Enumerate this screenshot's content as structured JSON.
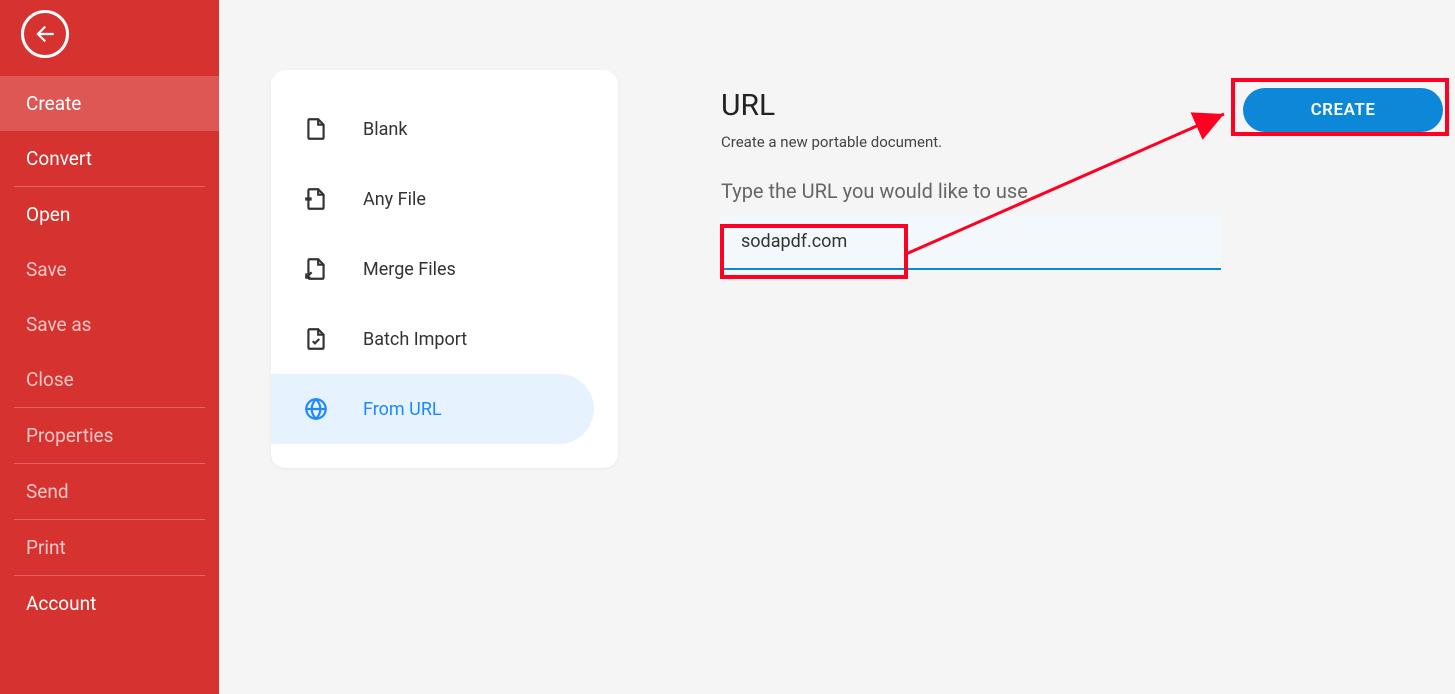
{
  "sidebar": {
    "items": [
      {
        "label": "Create",
        "active": true,
        "bright": true,
        "divider": false
      },
      {
        "label": "Convert",
        "active": false,
        "bright": true,
        "divider": true
      },
      {
        "label": "Open",
        "active": false,
        "bright": true,
        "divider": false
      },
      {
        "label": "Save",
        "active": false,
        "bright": false,
        "divider": false
      },
      {
        "label": "Save as",
        "active": false,
        "bright": false,
        "divider": false
      },
      {
        "label": "Close",
        "active": false,
        "bright": false,
        "divider": true
      },
      {
        "label": "Properties",
        "active": false,
        "bright": false,
        "divider": true
      },
      {
        "label": "Send",
        "active": false,
        "bright": false,
        "divider": true
      },
      {
        "label": "Print",
        "active": false,
        "bright": false,
        "divider": true
      },
      {
        "label": "Account",
        "active": false,
        "bright": true,
        "divider": false
      }
    ]
  },
  "createOptions": {
    "items": [
      {
        "label": "Blank",
        "icon": "file-icon",
        "selected": false
      },
      {
        "label": "Any File",
        "icon": "anyfile-icon",
        "selected": false
      },
      {
        "label": "Merge Files",
        "icon": "merge-icon",
        "selected": false
      },
      {
        "label": "Batch Import",
        "icon": "batch-icon",
        "selected": false
      },
      {
        "label": "From URL",
        "icon": "globe-icon",
        "selected": true
      }
    ]
  },
  "main": {
    "title": "URL",
    "subtitle": "Create a new portable document.",
    "prompt": "Type the URL you would like to use",
    "urlValue": "sodapdf.com",
    "createLabel": "CREATE"
  }
}
